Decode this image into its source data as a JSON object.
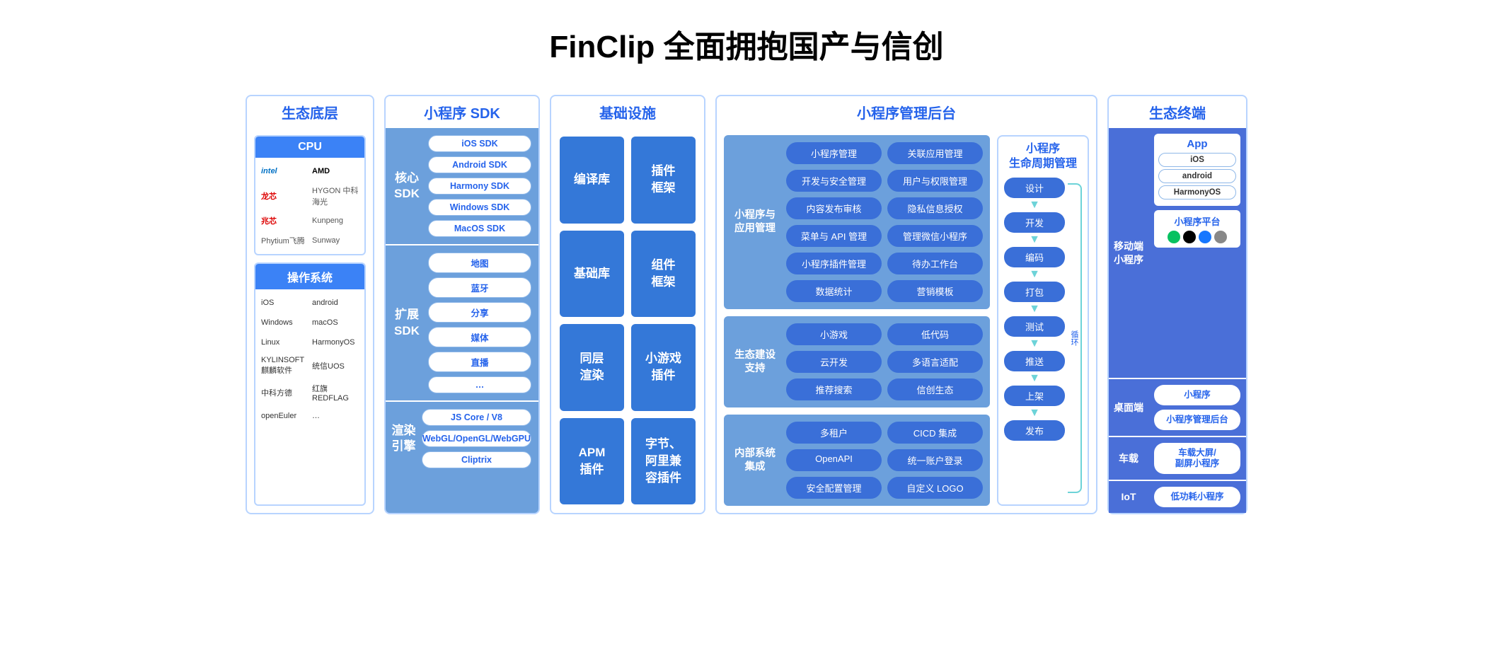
{
  "title": "FinClip 全面拥抱国产与信创",
  "col1": {
    "header": "生态底层",
    "cpu": {
      "title": "CPU",
      "items": [
        "intel",
        "AMD",
        "龙芯",
        "HYGON 中科海光",
        "兆芯",
        "Kunpeng",
        "Phytium飞腾",
        "Sunway"
      ]
    },
    "os": {
      "title": "操作系统",
      "items": [
        "iOS",
        "android",
        "Windows",
        "macOS",
        "Linux",
        "HarmonyOS",
        "KYLINSOFT 麒麟软件",
        "统信UOS",
        "中科方德",
        "红旗 REDFLAG",
        "openEuler",
        "…"
      ]
    }
  },
  "col2": {
    "header": "小程序 SDK",
    "blocks": [
      {
        "side": "核心\nSDK",
        "pills": [
          "iOS SDK",
          "Android SDK",
          "Harmony SDK",
          "Windows SDK",
          "MacOS SDK"
        ]
      },
      {
        "side": "扩展\nSDK",
        "pills": [
          "地图",
          "蓝牙",
          "分享",
          "媒体",
          "直播",
          "…"
        ]
      },
      {
        "side": "渲染\n引擎",
        "pills": [
          "JS Core / V8",
          "WebGL/OpenGL/WebGPU",
          "Cliptrix"
        ]
      }
    ]
  },
  "col3": {
    "header": "基础设施",
    "boxes": [
      "编译库",
      "插件\n框架",
      "基础库",
      "组件\n框架",
      "同层\n渲染",
      "小游戏\n插件",
      "APM\n插件",
      "字节、\n阿里兼\n容插件"
    ]
  },
  "col4": {
    "header": "小程序管理后台",
    "rows": [
      {
        "side": "小程序与\n应用管理",
        "pills": [
          "小程序管理",
          "关联应用管理",
          "开发与安全管理",
          "用户与权限管理",
          "内容发布审核",
          "隐私信息授权",
          "菜单与 API 管理",
          "管理微信小程序",
          "小程序插件管理",
          "待办工作台",
          "数据统计",
          "营销模板"
        ]
      },
      {
        "side": "生态建设\n支持",
        "pills": [
          "小游戏",
          "低代码",
          "云开发",
          "多语言适配",
          "推荐搜索",
          "信创生态"
        ]
      },
      {
        "side": "内部系统\n集成",
        "pills": [
          "多租户",
          "CICD 集成",
          "OpenAPI",
          "统一账户登录",
          "安全配置管理",
          "自定义 LOGO"
        ]
      }
    ]
  },
  "col5": {
    "title": "小程序\n生命周期管理",
    "steps": [
      "设计",
      "开发",
      "编码",
      "打包",
      "测试",
      "推送",
      "上架",
      "发布"
    ],
    "loop": "循环"
  },
  "col6": {
    "header": "生态终端",
    "rows": [
      {
        "side": "移动端\n小程序",
        "type": "app"
      },
      {
        "side": "桌面端",
        "pills": [
          "小程序",
          "小程序管理后台"
        ]
      },
      {
        "side": "车载",
        "pills": [
          "车载大屏/\n副屏小程序"
        ]
      },
      {
        "side": "IoT",
        "pills": [
          "低功耗小程序"
        ]
      }
    ],
    "app": {
      "title": "App",
      "os": [
        "iOS",
        "android",
        "HarmonyOS"
      ],
      "plat": "小程序平台"
    }
  }
}
